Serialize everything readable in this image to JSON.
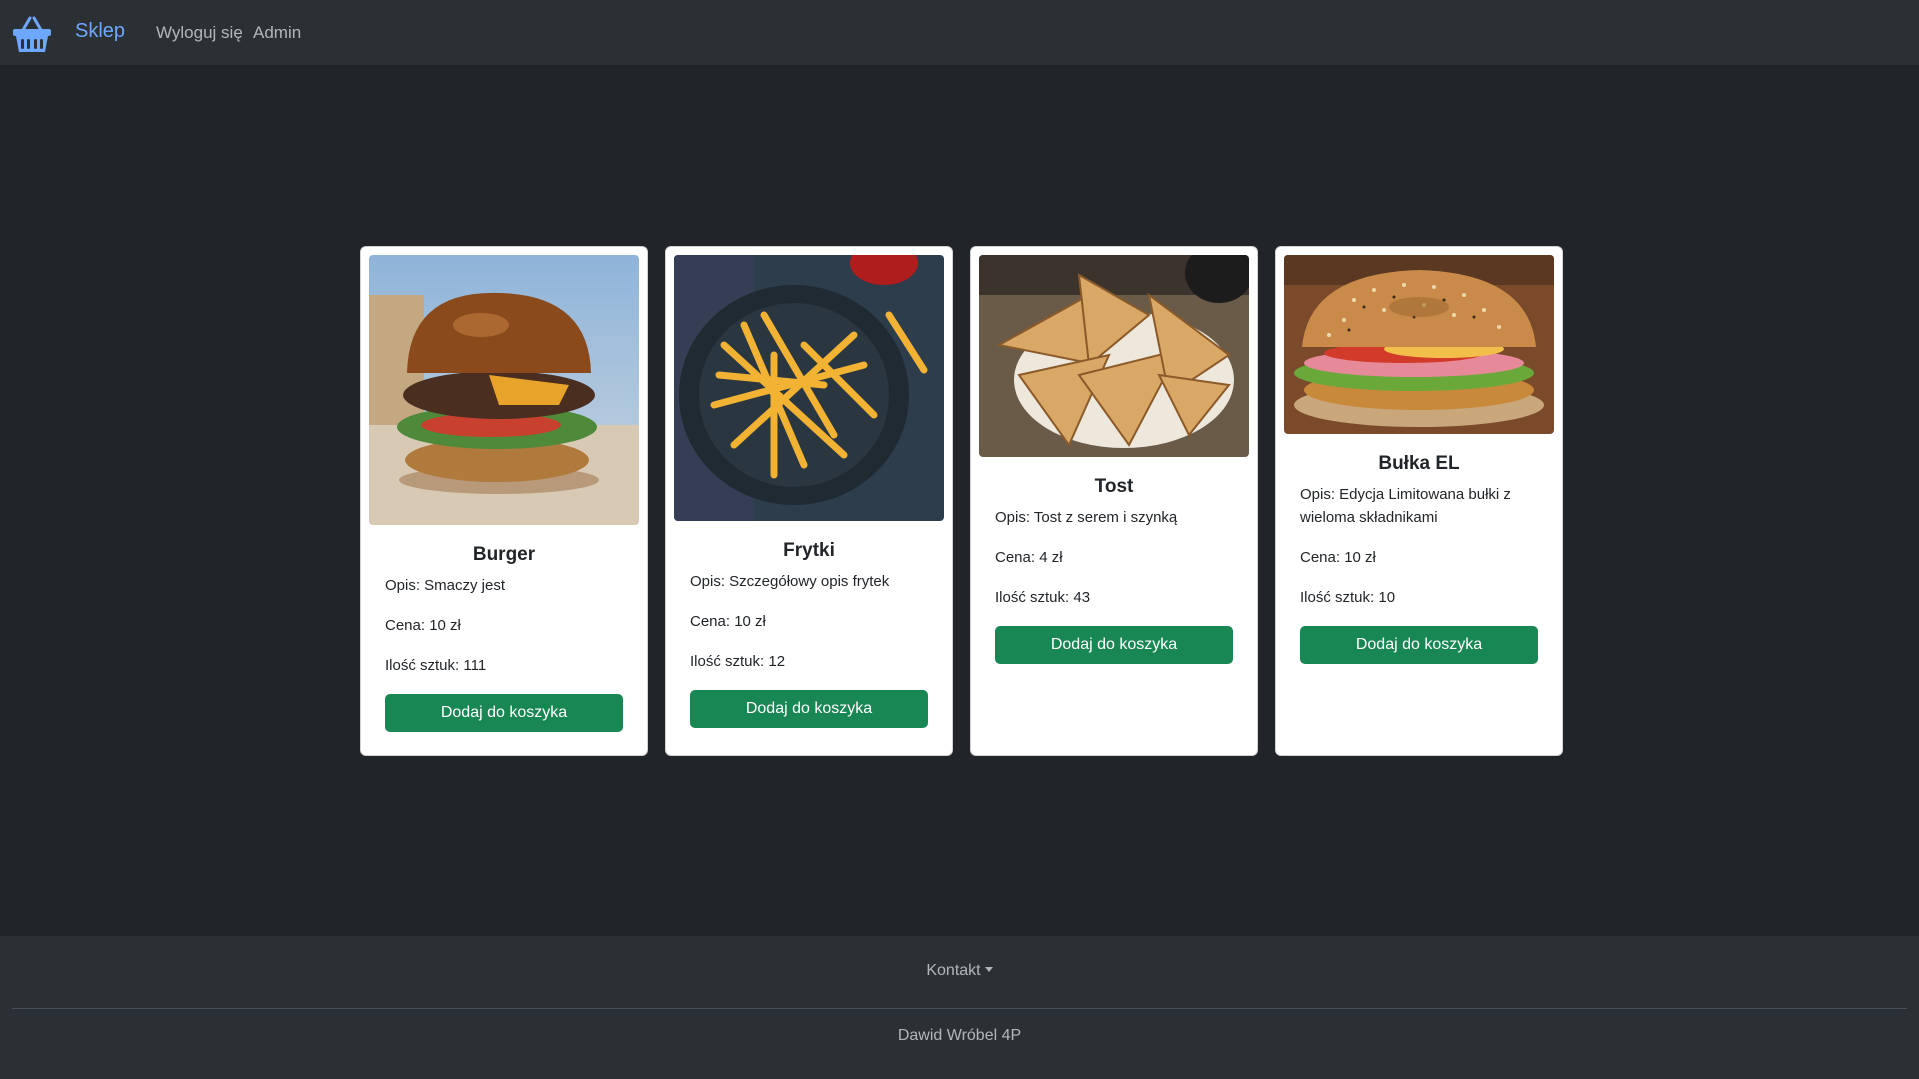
{
  "navbar": {
    "brand": "Sklep",
    "brand_icon": "basket-icon",
    "links": [
      "Wyloguj się",
      "Admin"
    ]
  },
  "products": [
    {
      "name": "Burger",
      "description": "Opis: Smaczy jest",
      "price": "Cena: 10 zł",
      "quantity": "Ilość sztuk: 111",
      "button": "Dodaj do koszyka"
    },
    {
      "name": "Frytki",
      "description": "Opis: Szczegółowy opis frytek",
      "price": "Cena: 10 zł",
      "quantity": "Ilość sztuk: 12",
      "button": "Dodaj do koszyka"
    },
    {
      "name": "Tost",
      "description": "Opis: Tost z serem i szynką",
      "price": "Cena: 4 zł",
      "quantity": "Ilość sztuk: 43",
      "button": "Dodaj do koszyka"
    },
    {
      "name": "Bułka EL",
      "description": "Opis: Edycja Limitowana bułki z wieloma składnikami",
      "price": "Cena: 10 zł",
      "quantity": "Ilość sztuk: 10",
      "button": "Dodaj do koszyka"
    }
  ],
  "footer": {
    "contact": "Kontakt",
    "author": "Dawid Wróbel 4P"
  },
  "colors": {
    "background": "#212529",
    "navbar": "#2b3035",
    "brand": "#6ea8fe",
    "button": "#198754"
  }
}
